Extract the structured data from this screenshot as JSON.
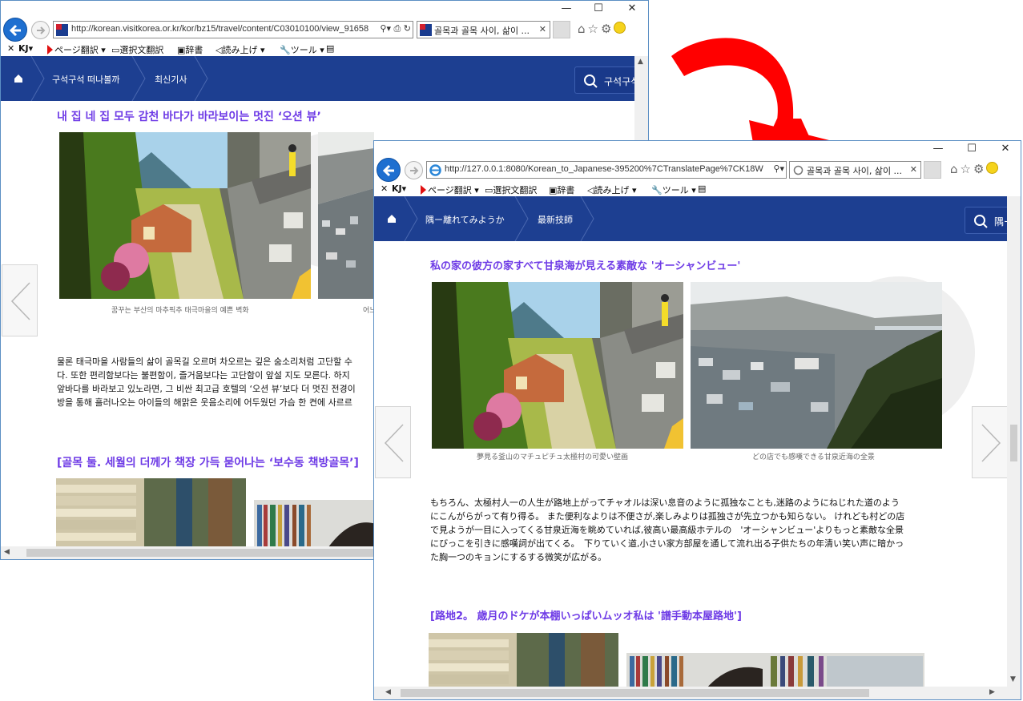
{
  "window_back": {
    "url": "http://korean.visitkorea.or.kr/kor/bz15/travel/content/C03010100/view_91658",
    "tab_title": "골목과 골목 사이, 삶이 ...",
    "nav": {
      "item1": "구석구석 떠나볼까",
      "item2": "최신기사",
      "search": "구석구석"
    },
    "toolbar": {
      "kj": "KJ",
      "page_translate": "ページ翻訳",
      "selection_translate": "選択文翻訳",
      "dictionary": "辞書",
      "read_aloud": "読み上げ",
      "tools": "ツール"
    },
    "heading1": "내 집 네 집 모두 감천 바다가 바라보이는 멋진 ‘오션 뷰’",
    "caption_left": "꿈꾸는 부산의 마추픽추 태극마을의 예쁜 벽화",
    "caption_right": "어느",
    "paragraph": [
      "물론 태극마을 사람들의 삶이 골목길 오르며 차오르는 깊은 숨소리처럼 고단할 수",
      "다. 또한 편리함보다는 불편함이, 즐거움보다는 고단함이 앞설 지도 모른다. 하지",
      "앞바다를 바라보고 있노라면, 그 비싼 최고급 호텔의 ‘오션 뷰’보다 더 멋진 전경이",
      "방을 통해 흘러나오는 아이들의 해맑은 웃음소리에 어두웠던 가슴 한 켠에 사르르"
    ],
    "heading2": "[골목 둘. 세월의 더께가 책장 가득 묻어나는 ‘보수동 책방골목’]"
  },
  "window_front": {
    "url": "http://127.0.0.1:8080/Korean_to_Japanese-395200%7CTranslatePage%7CK18W",
    "tab_title": "골목과 골목 사이, 삶이 ...",
    "nav": {
      "item1": "隅ー離れてみようか",
      "item2": "最新技師",
      "search": "隅ー"
    },
    "toolbar": {
      "kj": "KJ",
      "page_translate": "ページ翻訳",
      "selection_translate": "選択文翻訳",
      "dictionary": "辞書",
      "read_aloud": "読み上げ",
      "tools": "ツール"
    },
    "heading1": "私の家の彼方の家すべて甘泉海が見える素敵な 'オーシャンビュー'",
    "caption_left": "夢見る釜山のマチュピチュ太極村の可愛い壁画",
    "caption_right": "どの店でも感嘆できる甘泉近海の全景",
    "paragraph": [
      "もちろん、太極村人一の人生が路地上がってチャオルは深い息音のように孤独なことも,迷路のようにねじれた道のよう",
      "にこんがらがって有り得る。 また便利なよりは不便さが,楽しみよりは孤独さが先立つかも知らない。 けれども村どの店",
      "で見ようが一目に入ってくる甘泉近海を眺めていれば,彼高い最高級ホテルの　'オーシャンビュー'よりもっと素敵な全景",
      "にびっこを引きに感嘆詞が出てくる。　下りていく道,小さい家方部屋を通して流れ出る子供たちの年清い笑い声に暗かっ",
      "た胸一つのキョンにするする微笑が広がる。"
    ],
    "heading2": "[路地2。 歳月のドケが本棚いっぱいムッオ私は '譜手動本屋路地']"
  },
  "colors": {
    "nav_bg": "#1d3f91",
    "heading": "#6e3be6",
    "arrow": "#ff0000"
  }
}
